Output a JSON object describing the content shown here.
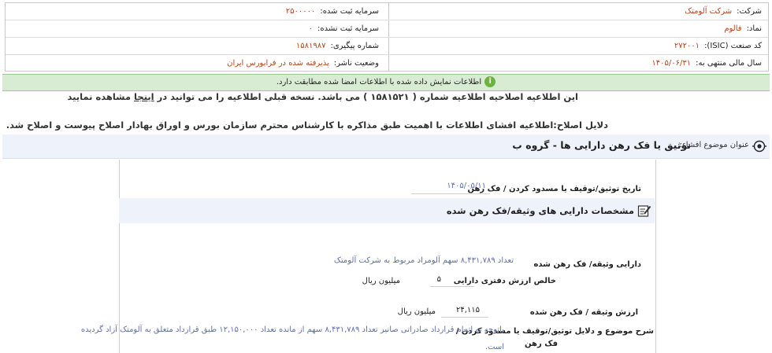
{
  "header": {
    "company_label": "شرکت:",
    "company_value": "شرکت آلومتک",
    "registered_capital_label": "سرمایه ثبت شده:",
    "registered_capital_value": "۲۵۰۰۰۰۰",
    "symbol_label": "نماد:",
    "symbol_value": "فالوم",
    "unregistered_capital_label": "سرمایه ثبت نشده:",
    "unregistered_capital_value": "۰",
    "isic_label": "کد صنعت (ISIC):",
    "isic_value": "۲۷۲۰۰۱",
    "tracking_label": "شماره پیگیری:",
    "tracking_value": "۱۵۸۱۹۸۷",
    "fiscal_year_label": "سال مالی منتهی به:",
    "fiscal_year_value": "۱۴۰۵/۰۶/۳۱",
    "publisher_status_label": "وضعیت ناشر:",
    "publisher_status_value": "پذیرفته شده در فرابورس ایران"
  },
  "info_bar": {
    "text": "اطلاعات نمایش داده شده با اطلاعات امضا شده مطابقت دارد."
  },
  "correction_notice": {
    "text_before": "این اطلاعیه اصلاحیه اطلاعیه شماره ( ۱۵۸۱۵۲۱ ) می باشد. نسخه قبلی اطلاعیه را می توانید در ",
    "link_text": "اینجا",
    "text_after": " مشاهده نمایید"
  },
  "correction_reason": {
    "text": "دلایل اصلاح:اطلاعیه افشای اطلاعات با اهمیت طبق مذاکره با کارشناس محترم سازمان بورس و اوراق بهادار اصلاح پیوست و اصلاح شد."
  },
  "subject": {
    "label": "عنوان موضوع افشاء:",
    "value": "توثیق یا فک رهن دارایی ها - گروه ب"
  },
  "details": {
    "date_label": "تاریخ توثیق/توقیف یا مسدود کردن / فک رهن",
    "date_value": "۱۴۰۵/۰۵/۱۱",
    "section_title": "مشخصات دارایی های وثیقه/فک رهن شده",
    "asset_label": "دارایی وثیقه/ فک رهن شده",
    "asset_value": "تعداد ۸,۴۳۱,۷۸۹ سهم آلومراد مربوط به شرکت آلومتک",
    "book_value_label": "خالص ارزش دفتری دارایی",
    "book_value_value": "۵",
    "book_value_unit": "میلیون ریال",
    "collateral_value_label": "ارزش وثیقه / فک رهن شده",
    "collateral_value_value": "۲۴,۱۱۵",
    "collateral_value_unit": "میلیون ریال",
    "description_label_line1": "شرح موضوع و دلایل توثیق/توقیف یا مسدود کردن /",
    "description_label_line2": "فک رهن",
    "description_value_line1": "باتوجه به اتمام قرارداد صادراتی صانیر تعداد ۸,۴۳۱,۷۸۹ سهم از مانده تعداد ۱۲,۱۵۰,۰۰۰ طبق قرارداد متعلق به آلومتک آزاد گردیده",
    "description_value_line2": "است."
  }
}
